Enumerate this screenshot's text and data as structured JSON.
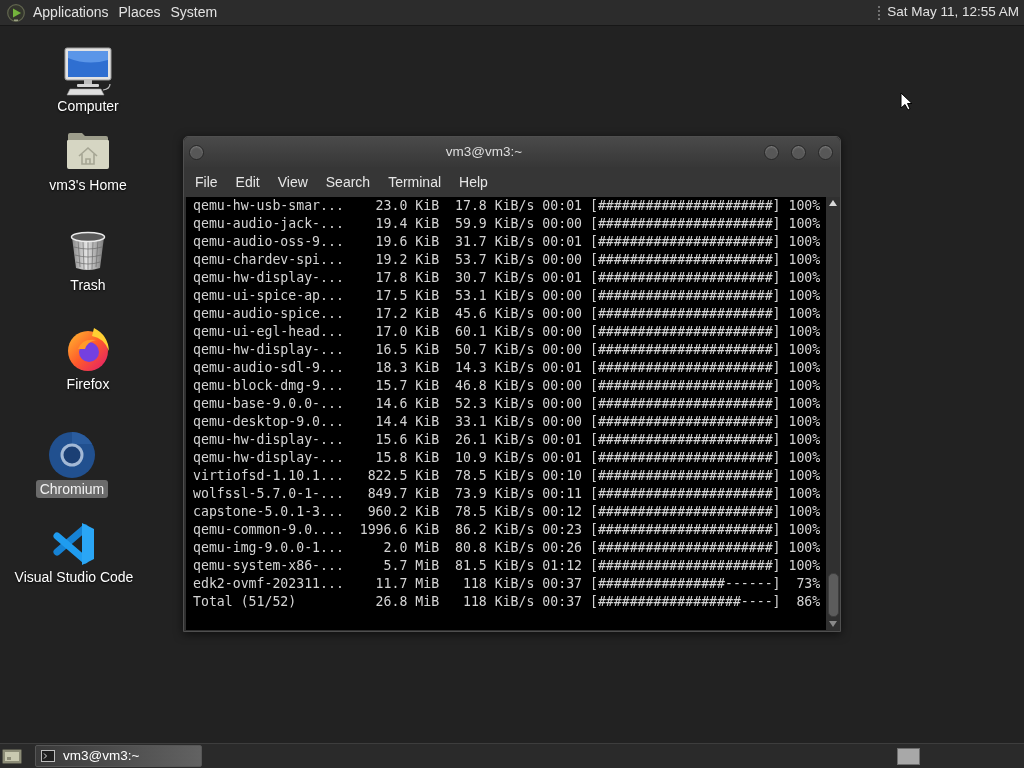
{
  "top_panel": {
    "menus": [
      "Applications",
      "Places",
      "System"
    ],
    "clock": "Sat May 11, 12:55 AM"
  },
  "desktop_icons": [
    {
      "kind": "computer",
      "label": "Computer",
      "selected": false
    },
    {
      "kind": "home",
      "label": "vm3's Home",
      "selected": false
    },
    {
      "kind": "trash",
      "label": "Trash",
      "selected": false
    },
    {
      "kind": "firefox",
      "label": "Firefox",
      "selected": false
    },
    {
      "kind": "chromium",
      "label": "Chromium",
      "selected": true
    },
    {
      "kind": "vscode",
      "label": "Visual Studio Code",
      "selected": false
    }
  ],
  "terminal_window": {
    "title": "vm3@vm3:~",
    "menus": [
      "File",
      "Edit",
      "View",
      "Search",
      "Terminal",
      "Help"
    ],
    "lines": [
      "qemu-hw-usb-smar...    23.0 KiB  17.8 KiB/s 00:01 [######################] 100%",
      "qemu-audio-jack-...    19.4 KiB  59.9 KiB/s 00:00 [######################] 100%",
      "qemu-audio-oss-9...    19.6 KiB  31.7 KiB/s 00:01 [######################] 100%",
      "qemu-chardev-spi...    19.2 KiB  53.7 KiB/s 00:00 [######################] 100%",
      "qemu-hw-display-...    17.8 KiB  30.7 KiB/s 00:01 [######################] 100%",
      "qemu-ui-spice-ap...    17.5 KiB  53.1 KiB/s 00:00 [######################] 100%",
      "qemu-audio-spice...    17.2 KiB  45.6 KiB/s 00:00 [######################] 100%",
      "qemu-ui-egl-head...    17.0 KiB  60.1 KiB/s 00:00 [######################] 100%",
      "qemu-hw-display-...    16.5 KiB  50.7 KiB/s 00:00 [######################] 100%",
      "qemu-audio-sdl-9...    18.3 KiB  14.3 KiB/s 00:01 [######################] 100%",
      "qemu-block-dmg-9...    15.7 KiB  46.8 KiB/s 00:00 [######################] 100%",
      "qemu-base-9.0.0-...    14.6 KiB  52.3 KiB/s 00:00 [######################] 100%",
      "qemu-desktop-9.0...    14.4 KiB  33.1 KiB/s 00:00 [######################] 100%",
      "qemu-hw-display-...    15.6 KiB  26.1 KiB/s 00:01 [######################] 100%",
      "qemu-hw-display-...    15.8 KiB  10.9 KiB/s 00:01 [######################] 100%",
      "virtiofsd-1.10.1...   822.5 KiB  78.5 KiB/s 00:10 [######################] 100%",
      "wolfssl-5.7.0-1-...   849.7 KiB  73.9 KiB/s 00:11 [######################] 100%",
      "capstone-5.0.1-3...   960.2 KiB  78.5 KiB/s 00:12 [######################] 100%",
      "qemu-common-9.0....  1996.6 KiB  86.2 KiB/s 00:23 [######################] 100%",
      "qemu-img-9.0.0-1...     2.0 MiB  80.8 KiB/s 00:26 [######################] 100%",
      "qemu-system-x86-...     5.7 MiB  81.5 KiB/s 01:12 [######################] 100%",
      "edk2-ovmf-202311...    11.7 MiB   118 KiB/s 00:37 [################------]  73%",
      "Total (51/52)          26.8 MiB   118 KiB/s 00:37 [##################----]  86%"
    ]
  },
  "bottom_panel": {
    "tasks": [
      {
        "label": "vm3@vm3:~",
        "selected": true
      }
    ]
  }
}
